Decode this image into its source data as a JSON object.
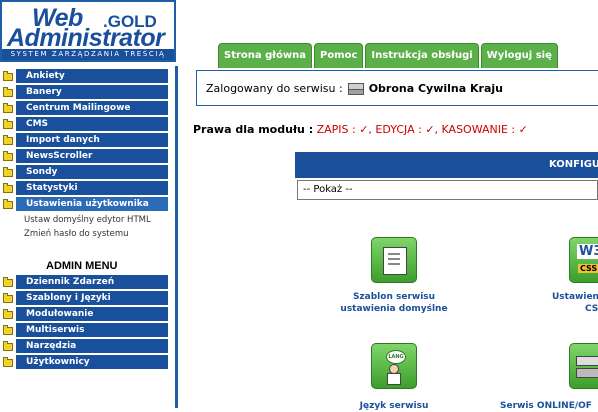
{
  "logo": {
    "web": "Web",
    "gold": ".GOLD",
    "administrator": "Administrator",
    "tagline": "SYSTEM ZARZĄDZANIA TREŚCIĄ"
  },
  "tabs": [
    "Strona główna",
    "Pomoc",
    "Instrukcja obsługi",
    "Wyloguj się"
  ],
  "sidebar": {
    "items": [
      "Ankiety",
      "Banery",
      "Centrum Mailingowe",
      "CMS",
      "Import danych",
      "NewsScroller",
      "Sondy",
      "Statystyki",
      "Ustawienia użytkownika"
    ],
    "sub_items": [
      "Ustaw domyślny edytor HTML",
      "Zmień hasło do systemu"
    ],
    "admin_heading": "ADMIN MENU",
    "admin_items": [
      "Dziennik Zdarzeń",
      "Szablony i Języki",
      "Modułowanie",
      "Multiserwis",
      "Narzędzia",
      "Użytkownicy"
    ]
  },
  "login": {
    "prefix": "Zalogowany do serwisu :",
    "service": "Obrona Cywilna Kraju"
  },
  "permissions": {
    "label": "Prawa dla modułu :",
    "text": "ZAPIS : ✓, EDYCJA : ✓, KASOWANIE : ✓"
  },
  "config": {
    "header": "KONFIGU",
    "select_value": "-- Pokaż --"
  },
  "tiles": {
    "t1_line1": "Szablon serwisu",
    "t1_line2": "ustawienia domyślne",
    "t2_line1": "Ustawien",
    "t2_line2": "CS",
    "t3_line1": "Język serwisu",
    "t4_line1": "Serwis ONLINE/OF"
  },
  "icons": {
    "folder": "folder-icon",
    "server": "server-icon",
    "template": "template-icon",
    "w3css": "w3c-css-icon",
    "language": "language-icon",
    "online": "server-online-icon"
  }
}
